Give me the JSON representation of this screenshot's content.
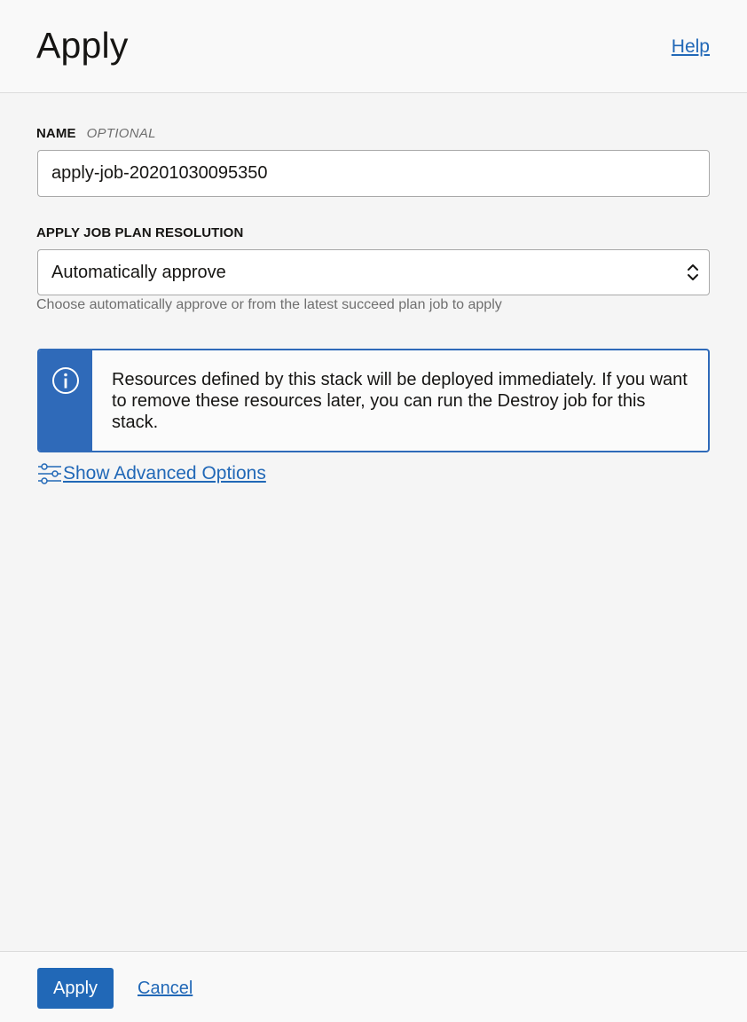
{
  "header": {
    "title": "Apply",
    "help_label": "Help"
  },
  "form": {
    "name": {
      "label": "NAME",
      "optional_label": "OPTIONAL",
      "value": "apply-job-20201030095350"
    },
    "plan_resolution": {
      "label": "APPLY JOB PLAN RESOLUTION",
      "selected": "Automatically approve",
      "help_text": "Choose automatically approve or from the latest succeed plan job to apply"
    }
  },
  "info_box": {
    "icon": "info-circle-icon",
    "text": "Resources defined by this stack will be deployed immediately. If you want to remove these resources later, you can run the Destroy job for this stack."
  },
  "advanced": {
    "icon": "sliders-icon",
    "label": "Show Advanced Options"
  },
  "footer": {
    "apply_label": "Apply",
    "cancel_label": "Cancel"
  },
  "colors": {
    "accent": "#2168b7",
    "info_border": "#2f6ab9",
    "background": "#f5f5f5"
  }
}
